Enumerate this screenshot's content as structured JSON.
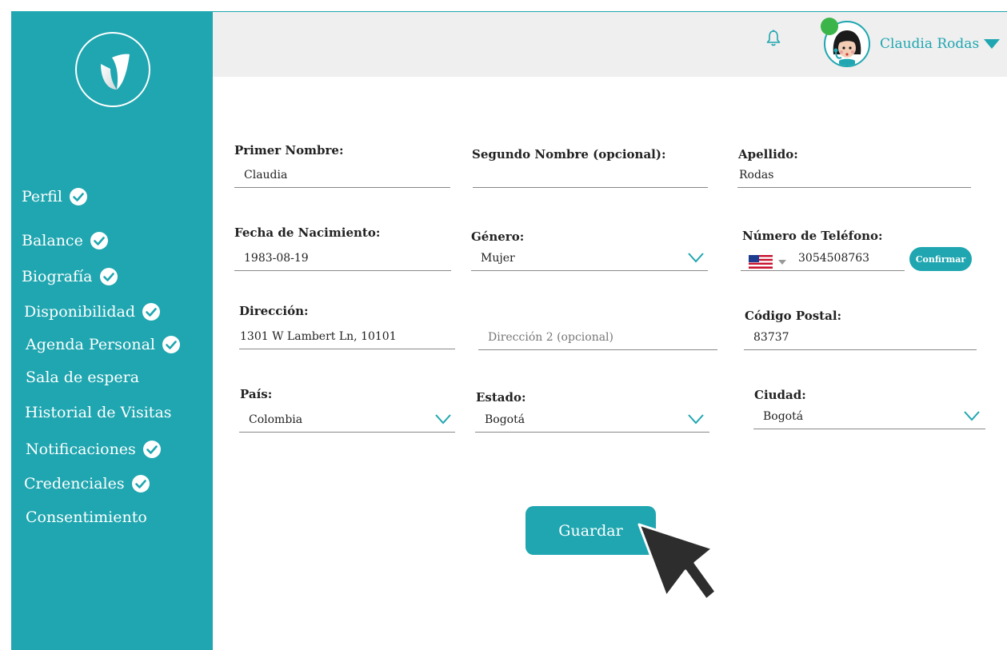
{
  "sidebar": {
    "items": [
      {
        "label": "Perfil",
        "checked": true
      },
      {
        "label": "Balance",
        "checked": true
      },
      {
        "label": "Biografía",
        "checked": true
      },
      {
        "label": "Disponibilidad",
        "checked": true
      },
      {
        "label": "Agenda Personal",
        "checked": true
      },
      {
        "label": "Sala de espera",
        "checked": false
      },
      {
        "label": "Historial de Visitas",
        "checked": false
      },
      {
        "label": "Notificaciones",
        "checked": true
      },
      {
        "label": "Credenciales",
        "checked": true
      },
      {
        "label": "Consentimiento",
        "checked": false
      }
    ]
  },
  "header": {
    "user_name": "Claudia Rodas",
    "icons": [
      "bell-icon",
      "avatar",
      "caret-down-icon"
    ]
  },
  "form": {
    "first_name": {
      "label": "Primer Nombre:",
      "value": "Claudia"
    },
    "middle_name": {
      "label": "Segundo Nombre (opcional):",
      "value": ""
    },
    "last_name": {
      "label": "Apellido:",
      "value": "Rodas"
    },
    "birth_date": {
      "label": "Fecha de Nacimiento:",
      "value": "1983-08-19"
    },
    "gender": {
      "label": "Género:",
      "value": "Mujer"
    },
    "phone": {
      "label": "Número de Teléfono:",
      "value": "3054508763",
      "confirm_label": "Confirmar"
    },
    "address": {
      "label": "Dirección:",
      "value": "1301 W Lambert Ln, 10101"
    },
    "address2": {
      "placeholder": "Dirección 2 (opcional)"
    },
    "postal_code": {
      "label": "Código Postal:",
      "value": "83737"
    },
    "country": {
      "label": "País:",
      "value": "Colombia"
    },
    "state": {
      "label": "Estado:",
      "value": "Bogotá"
    },
    "city": {
      "label": "Ciudad:",
      "value": "Bogotá"
    }
  },
  "actions": {
    "save_label": "Guardar"
  },
  "colors": {
    "accent": "#1fa6b0",
    "online": "#3bb54a",
    "topbar": "#efefef"
  }
}
